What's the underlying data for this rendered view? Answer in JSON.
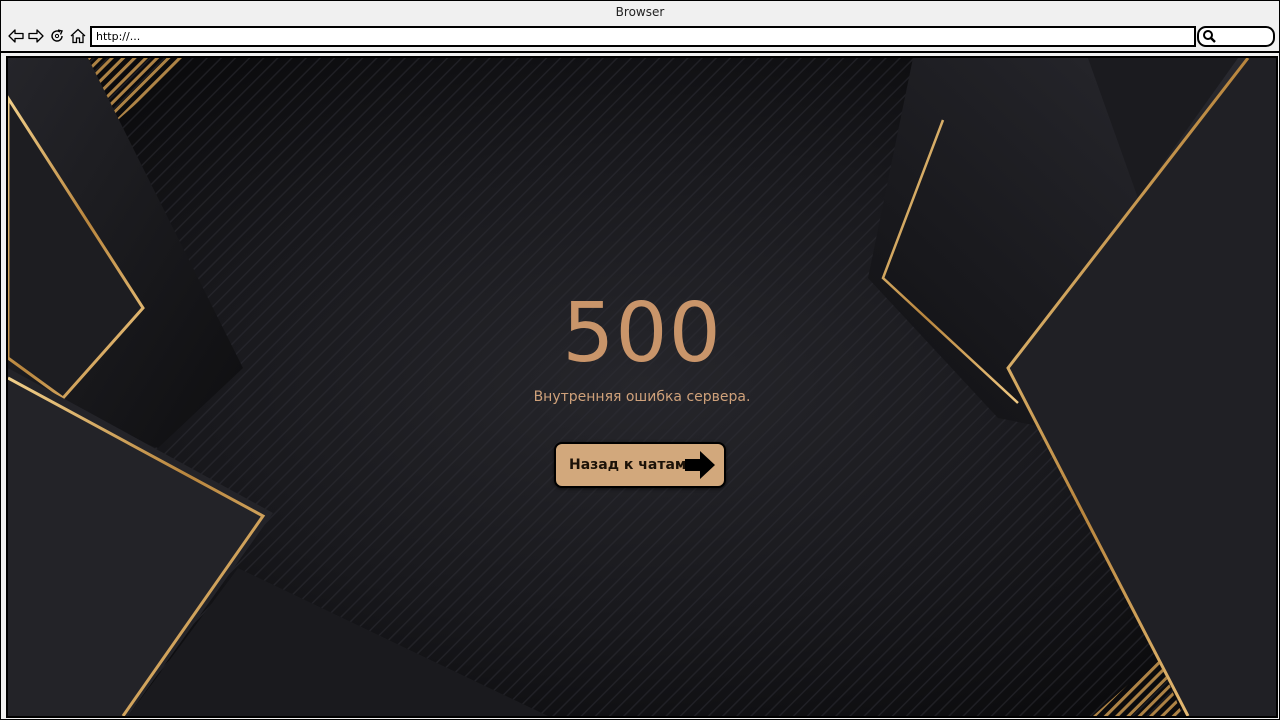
{
  "browser": {
    "title": "Browser",
    "address": "http://...",
    "nav": {
      "back_icon": "back-arrow-icon",
      "forward_icon": "forward-arrow-icon",
      "reload_icon": "reload-icon",
      "home_icon": "home-icon",
      "search_icon": "search-icon"
    }
  },
  "page": {
    "error_code": "500",
    "error_message": "Внутренняя ошибка сервера.",
    "back_button_label": "Назад к чатам",
    "back_button_icon": "arrow-right-icon"
  },
  "colors": {
    "accent": "#c9956a",
    "button_bg": "#d2a87c",
    "background": "#151518",
    "gold_line": "#e0b46a"
  }
}
